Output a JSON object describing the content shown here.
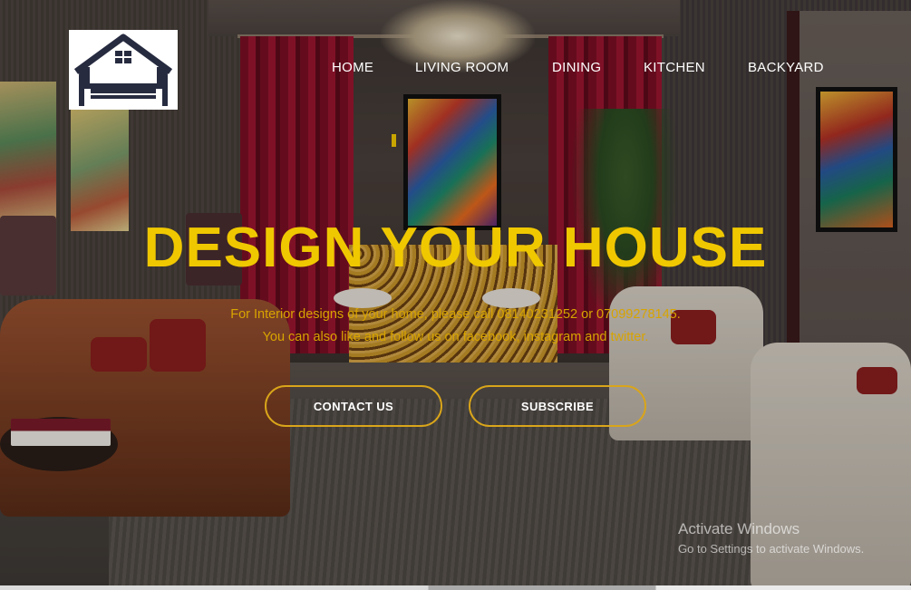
{
  "logo": {
    "icon": "house-sofa-icon"
  },
  "nav": {
    "items": [
      {
        "label": "HOME"
      },
      {
        "label": "LIVING ROOM"
      },
      {
        "label": "DINING"
      },
      {
        "label": "KITCHEN"
      },
      {
        "label": "BACKYARD"
      }
    ]
  },
  "hero": {
    "title": "DESIGN YOUR HOUSE",
    "subtitle_line1": "For Interior designs of your home, please call 08140231252 or 07099278145.",
    "subtitle_line2": "You can also like and follow us on facebook, instagram and twitter."
  },
  "buttons": {
    "contact": "CONTACT US",
    "subscribe": "SUBSCRIBE"
  },
  "watermark": {
    "title": "Activate Windows",
    "subtitle": "Go to Settings to activate Windows."
  },
  "colors": {
    "accent": "#f0c800",
    "subtitle": "#d8a400",
    "button_border": "#d9a51a",
    "nav_text": "#ffffff"
  }
}
